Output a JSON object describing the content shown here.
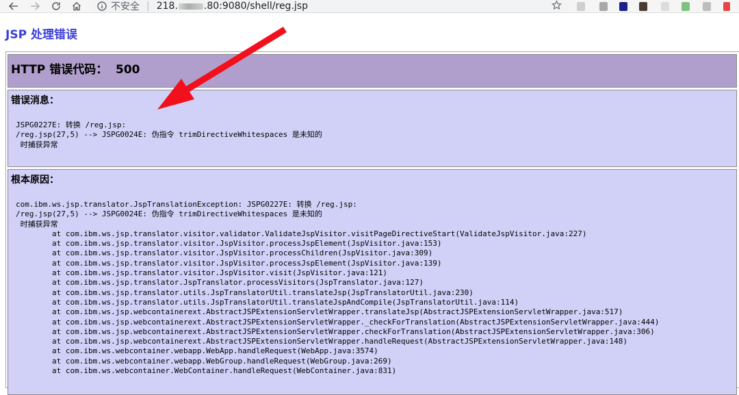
{
  "browser": {
    "back_icon": "arrow-left-icon",
    "forward_icon": "arrow-right-icon",
    "reload_icon": "reload-icon",
    "home_icon": "home-icon",
    "security_label": "不安全",
    "url_host": "218.",
    "url_rest": ".80:9080/shell/reg.jsp",
    "star_icon": "star-icon"
  },
  "page": {
    "title": "JSP 处理错误",
    "http_error": "HTTP 错误代码：  500",
    "message_heading": "错误消息：",
    "message_lines": [
      "JSPG0227E: 转换 /reg.jsp:",
      "/reg.jsp(27,5) --> JSPG0024E: 伪指令 trimDirectiveWhitespaces 是未知的",
      " 时捕获异常"
    ],
    "root_cause_heading": "根本原因：",
    "root_cause_lines": [
      "com.ibm.ws.jsp.translator.JspTranslationException: JSPG0227E: 转换 /reg.jsp:",
      "/reg.jsp(27,5) --> JSPG0024E: 伪指令 trimDirectiveWhitespaces 是未知的",
      " 时捕获异常",
      "        at com.ibm.ws.jsp.translator.visitor.validator.ValidateJspVisitor.visitPageDirectiveStart(ValidateJspVisitor.java:227)",
      "        at com.ibm.ws.jsp.translator.visitor.JspVisitor.processJspElement(JspVisitor.java:153)",
      "        at com.ibm.ws.jsp.translator.visitor.JspVisitor.processChildren(JspVisitor.java:309)",
      "        at com.ibm.ws.jsp.translator.visitor.JspVisitor.processJspElement(JspVisitor.java:139)",
      "        at com.ibm.ws.jsp.translator.visitor.JspVisitor.visit(JspVisitor.java:121)",
      "        at com.ibm.ws.jsp.translator.JspTranslator.processVisitors(JspTranslator.java:127)",
      "        at com.ibm.ws.jsp.translator.utils.JspTranslatorUtil.translateJsp(JspTranslatorUtil.java:230)",
      "        at com.ibm.ws.jsp.translator.utils.JspTranslatorUtil.translateJspAndCompile(JspTranslatorUtil.java:114)",
      "        at com.ibm.ws.jsp.webcontainerext.AbstractJSPExtensionServletWrapper.translateJsp(AbstractJSPExtensionServletWrapper.java:517)",
      "        at com.ibm.ws.jsp.webcontainerext.AbstractJSPExtensionServletWrapper._checkForTranslation(AbstractJSPExtensionServletWrapper.java:444)",
      "        at com.ibm.ws.jsp.webcontainerext.AbstractJSPExtensionServletWrapper.checkForTranslation(AbstractJSPExtensionServletWrapper.java:306)",
      "        at com.ibm.ws.jsp.webcontainerext.AbstractJSPExtensionServletWrapper.handleRequest(AbstractJSPExtensionServletWrapper.java:148)",
      "        at com.ibm.ws.webcontainer.webapp.WebApp.handleRequest(WebApp.java:3574)",
      "        at com.ibm.ws.webcontainer.webapp.WebGroup.handleRequest(WebGroup.java:269)",
      "        at com.ibm.ws.webcontainer.WebContainer.handleRequest(WebContainer.java:831)"
    ]
  },
  "annotation": {
    "arrow_icon": "red-arrow-icon",
    "color": "#f2101c"
  },
  "colors": {
    "title": "#3b3fd6",
    "http_bg": "#b09fcc",
    "section_bg": "#d1d1f8"
  }
}
